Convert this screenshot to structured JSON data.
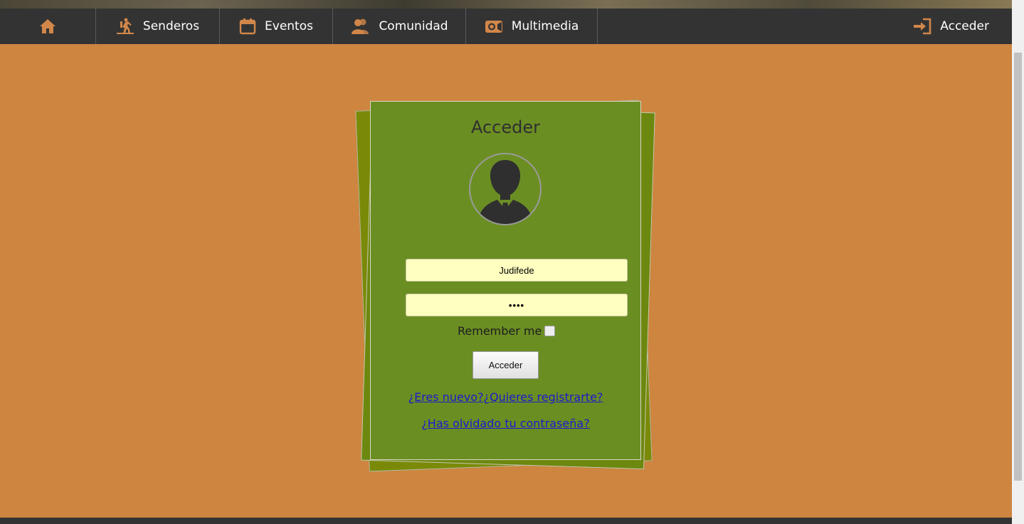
{
  "nav": {
    "items": [
      {
        "icon": "home-icon",
        "label": ""
      },
      {
        "icon": "hiker-icon",
        "label": "Senderos"
      },
      {
        "icon": "calendar-icon",
        "label": "Eventos"
      },
      {
        "icon": "users-icon",
        "label": "Comunidad"
      },
      {
        "icon": "camera-icon",
        "label": "Multimedia"
      }
    ],
    "login": {
      "icon": "sign-in-icon",
      "label": "Acceder"
    }
  },
  "login_card": {
    "title": "Acceder",
    "avatar_icon": "user-avatar-icon",
    "username_value": "Judifede",
    "password_value": "••••",
    "remember_label": "Remember me",
    "submit_label": "Acceder",
    "register_link": "¿Eres nuevo?¿Quieres registrarte?",
    "forgot_link": "¿Has olvidado tu contraseña?"
  },
  "colors": {
    "page_background": "#CD853F",
    "nav_background": "#333333",
    "nav_icon": "#D2874A",
    "card_background": "#6B8E23",
    "input_background": "#FFFFC0",
    "link": "#1A1ACC"
  }
}
